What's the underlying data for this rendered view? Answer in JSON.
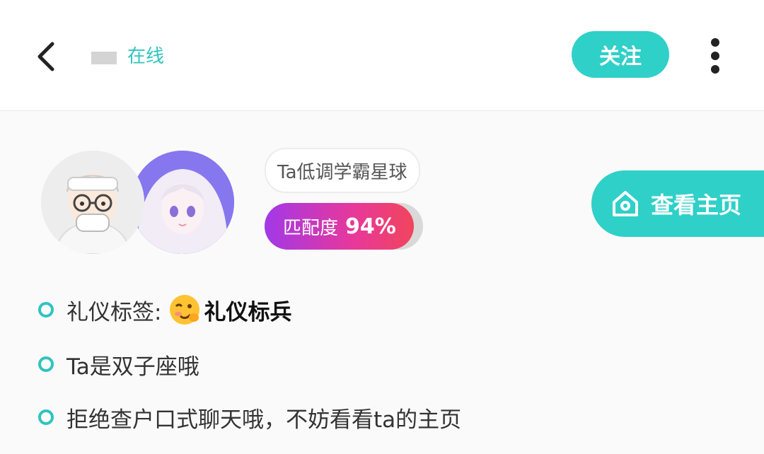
{
  "theme": {
    "accent": "#2fd0c8",
    "online_color": "#2fc4c0",
    "bullet_color": "#2fc4c0"
  },
  "header": {
    "back_icon": "chevron-left-icon",
    "status": "在线",
    "follow_label": "关注",
    "more_icon": "vertical-dots-icon"
  },
  "profile": {
    "planet_tag": "Ta低调学霸星球",
    "match_label": "匹配度",
    "match_value": "94%",
    "match_fraction": 0.94,
    "homepage_label": "查看主页",
    "homepage_icon": "home-icon"
  },
  "info": {
    "etiquette_label": "礼仪标签:",
    "etiquette_emoji": "wink-face-emoji-icon",
    "etiquette_value": "礼仪标兵",
    "zodiac": "Ta是双子座哦",
    "hint": "拒绝查户口式聊天哦，不妨看看ta的主页"
  }
}
